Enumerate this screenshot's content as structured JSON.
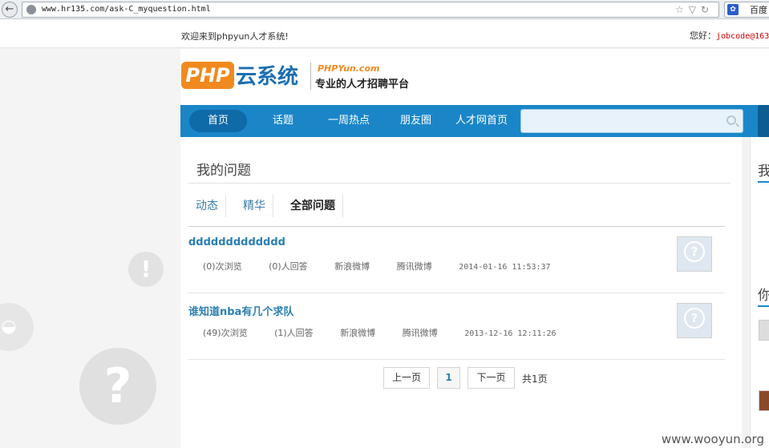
{
  "browser": {
    "url": "www.hr135.com/ask-C_myquestion.html",
    "search_engine": "百度"
  },
  "topbar": {
    "welcome": "欢迎来到phpyun人才系统!",
    "greeting": "您好：",
    "username": "jobcode@163"
  },
  "logo": {
    "php": "PHP",
    "yun": "云系统",
    "brand": "PHPYun.com",
    "slogan": "专业的人才招聘平台"
  },
  "nav": {
    "items": [
      {
        "label": "首页",
        "active": true
      },
      {
        "label": "话题",
        "active": false
      },
      {
        "label": "一周热点",
        "active": false
      },
      {
        "label": "朋友圈",
        "active": false
      },
      {
        "label": "人才网首页",
        "active": false
      }
    ],
    "search_placeholder": ""
  },
  "main": {
    "title": "我的问题",
    "tabs": [
      {
        "label": "动态",
        "active": false
      },
      {
        "label": "精华",
        "active": false
      },
      {
        "label": "全部问题",
        "active": true
      }
    ],
    "questions": [
      {
        "title": "ddddddddddddd",
        "views": "(0)次浏览",
        "answers": "(0)人回答",
        "share_sina": "新浪微博",
        "share_tencent": "腾讯微博",
        "date": "2014-01-16 11:53:37"
      },
      {
        "title": "谁知道nba有几个求队",
        "views": "(49)次浏览",
        "answers": "(1)人回答",
        "share_sina": "新浪微博",
        "share_tencent": "腾讯微博",
        "date": "2013-12-16 12:11:26"
      }
    ],
    "pager": {
      "prev": "上一页",
      "current": "1",
      "next": "下一页",
      "total": "共1页"
    }
  },
  "sidebar": {
    "title_1": "我",
    "title_2": "你"
  },
  "watermark": "www.wooyun.org",
  "colors": {
    "nav_blue": "#1a86c8",
    "link_blue": "#2a7fb3",
    "logo_orange": "#f08a1e"
  }
}
